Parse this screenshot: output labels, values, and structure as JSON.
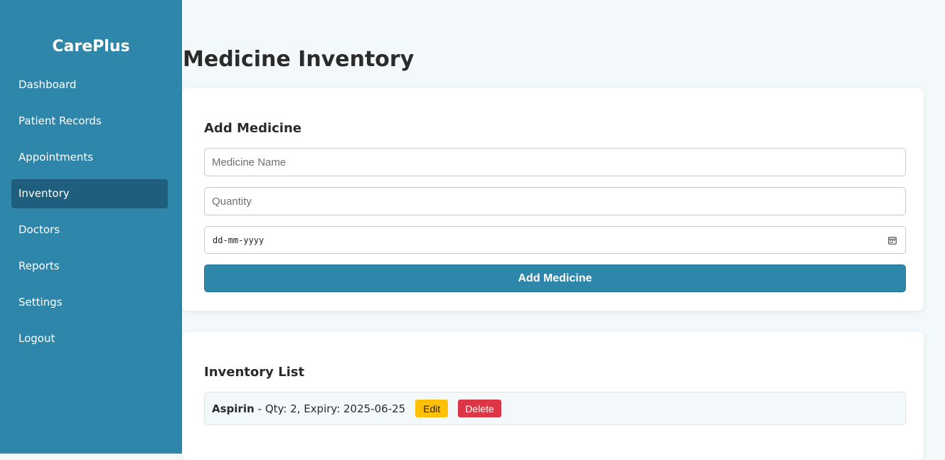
{
  "sidebar": {
    "brand": "CarePlus",
    "items": [
      {
        "label": "Dashboard"
      },
      {
        "label": "Patient Records"
      },
      {
        "label": "Appointments"
      },
      {
        "label": "Inventory"
      },
      {
        "label": "Doctors"
      },
      {
        "label": "Reports"
      },
      {
        "label": "Settings"
      },
      {
        "label": "Logout"
      }
    ],
    "active_index": 3
  },
  "main": {
    "title": "Medicine Inventory",
    "add_form": {
      "title": "Add Medicine",
      "name_placeholder": "Medicine Name",
      "quantity_placeholder": "Quantity",
      "date_placeholder": "dd-mm-yyyy",
      "submit_label": "Add Medicine"
    },
    "inventory": {
      "title": "Inventory List",
      "items": [
        {
          "name": "Aspirin",
          "meta": "- Qty: 2, Expiry: 2025-06-25",
          "edit_label": "Edit",
          "delete_label": "Delete"
        }
      ]
    }
  },
  "colors": {
    "sidebar_bg": "#2e86ab",
    "sidebar_active": "#1f5f7d",
    "edit_button": "#ffc107",
    "delete_button": "#dc3545",
    "page_bg": "#f3f8fb"
  },
  "icons": {
    "date_field": "calendar-icon"
  }
}
